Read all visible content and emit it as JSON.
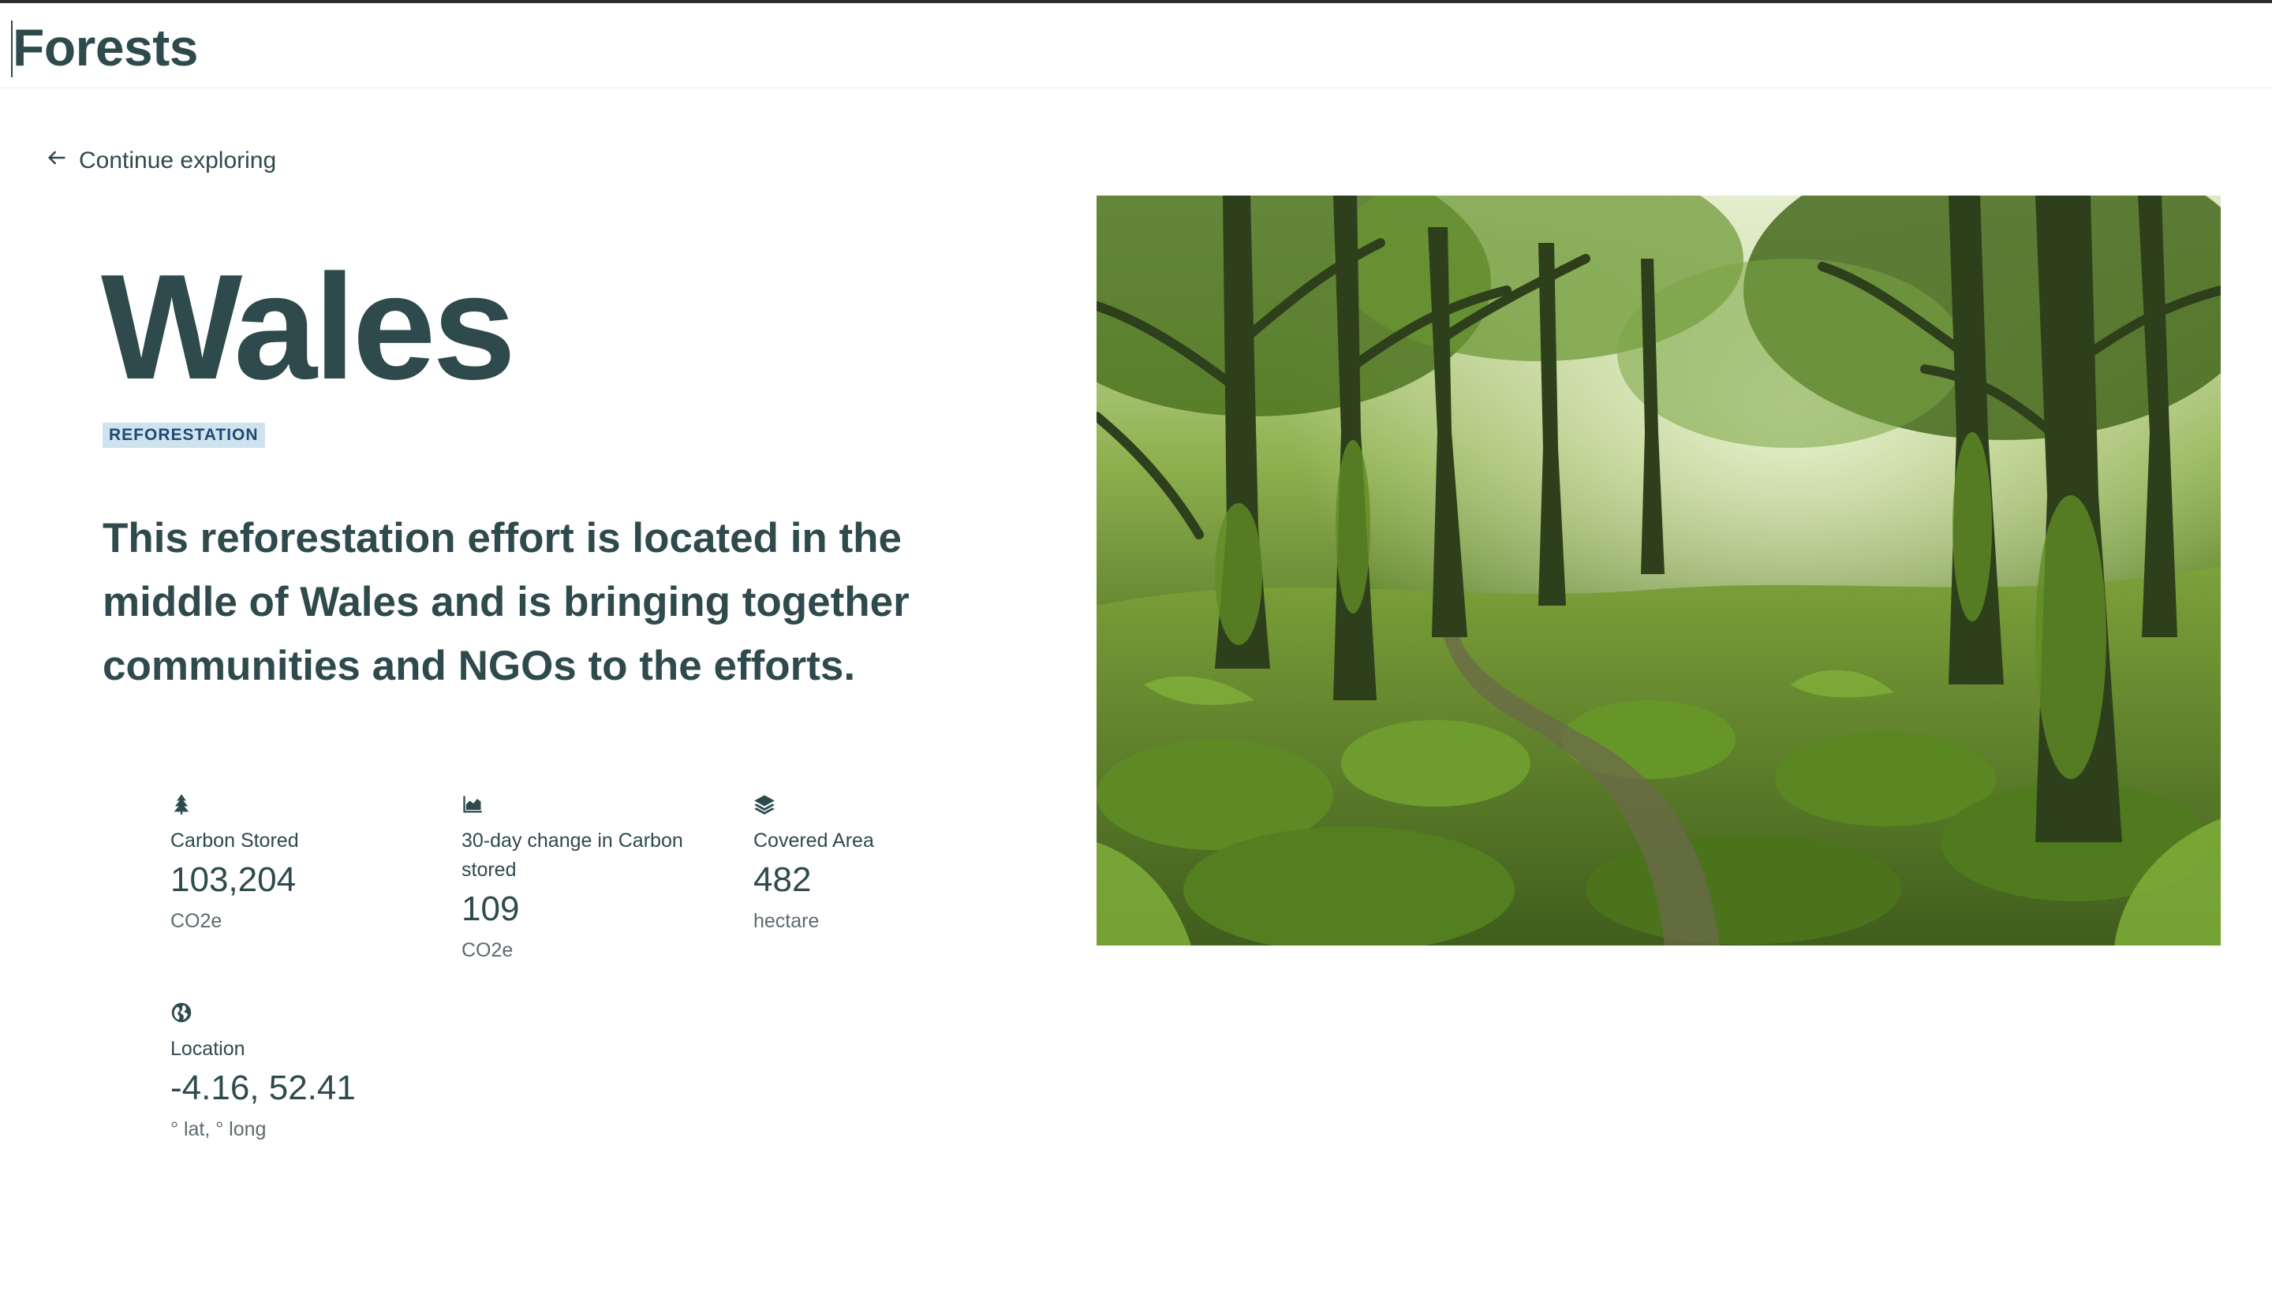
{
  "header": {
    "app_title": "Forests"
  },
  "nav": {
    "back_label": "Continue exploring",
    "back_icon": "arrow-left-icon"
  },
  "project": {
    "name": "Wales",
    "tag": "REFORESTATION",
    "description": "This reforestation effort is located in the middle of Wales and is bringing together communities and NGOs to the efforts."
  },
  "stats": [
    {
      "icon": "tree-icon",
      "label": "Carbon Stored",
      "value": "103,204",
      "unit": "CO2e"
    },
    {
      "icon": "area-chart-icon",
      "label": "30-day change in Carbon stored",
      "value": "109",
      "unit": "CO2e"
    },
    {
      "icon": "layers-icon",
      "label": "Covered Area",
      "value": "482",
      "unit": "hectare"
    },
    {
      "icon": "globe-icon",
      "label": "Location",
      "value": "-4.16, 52.41",
      "unit": "° lat, ° long"
    }
  ],
  "colors": {
    "text_primary": "#2f4a4d",
    "tag_background": "#cfe3ef",
    "tag_text": "#1f4a73"
  }
}
